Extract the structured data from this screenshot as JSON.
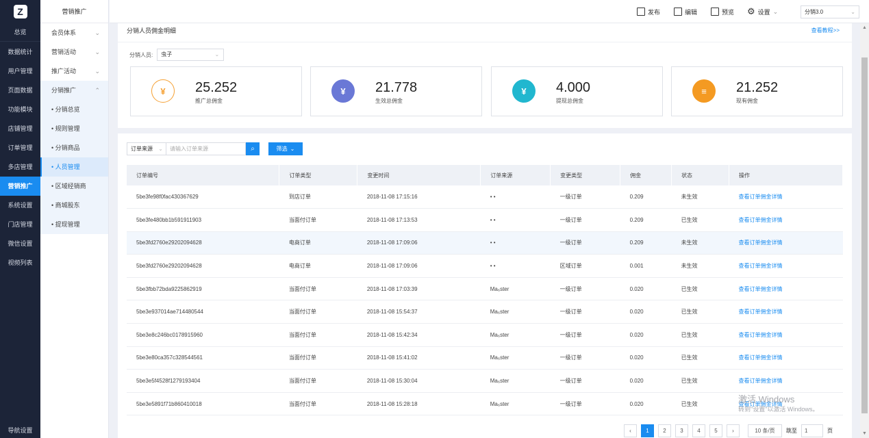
{
  "nav": {
    "logo": "Z",
    "items": [
      "总览",
      "数据统计",
      "用户管理",
      "页面数据",
      "功能模块",
      "店铺管理",
      "订单管理",
      "多店管理",
      "营销推广",
      "系统设置",
      "门店管理",
      "微信设置",
      "视频列表"
    ],
    "active_index": 8,
    "bottom": "导航设置"
  },
  "subnav": {
    "title": "营销推广",
    "groups": [
      {
        "label": "会员体系",
        "chev": "⌄"
      },
      {
        "label": "营销活动",
        "chev": "⌄"
      },
      {
        "label": "推广活动",
        "chev": "⌄"
      },
      {
        "label": "分销推广",
        "chev": "⌃"
      }
    ],
    "children": [
      "• 分销总览",
      "• 规则管理",
      "• 分销商品",
      "• 人员管理",
      "• 区域经销商",
      "• 商城股东",
      "• 提现管理"
    ],
    "active_child": 3
  },
  "topbar": {
    "publish": "发布",
    "edit": "编辑",
    "preview": "预览",
    "settings": "设置",
    "version": "分销3.0"
  },
  "page": {
    "title": "分销人员佣金明细",
    "help": "查看教程>>",
    "filter_label": "分销人员:",
    "filter_value": "虫子"
  },
  "stats": [
    {
      "value": "25.252",
      "label": "推广总佣金",
      "color": "#f5a033",
      "icon": "¥",
      "outline": true
    },
    {
      "value": "21.778",
      "label": "生效总佣金",
      "color": "#6a78d6",
      "icon": "¥",
      "outline": false
    },
    {
      "value": "4.000",
      "label": "提现总佣金",
      "color": "#21b7cf",
      "icon": "¥",
      "outline": false
    },
    {
      "value": "21.252",
      "label": "现有佣金",
      "color": "#f49a22",
      "icon": "≡",
      "outline": false
    }
  ],
  "search": {
    "source_select": "订单来源",
    "placeholder": "请输入订单来源",
    "filter_button": "筛选"
  },
  "table": {
    "headers": [
      "订单编号",
      "订单类型",
      "变更时间",
      "订单来源",
      "变更类型",
      "佣金",
      "状态",
      "操作"
    ],
    "rows": [
      [
        "5be3fe98f0fac430367629",
        "到店订单",
        "2018-11-08 17:15:16",
        "• •",
        "一级订单",
        "0.209",
        "未生效",
        "查看订单佣金详情"
      ],
      [
        "5be3fe480bb1b591911903",
        "当面付订单",
        "2018-11-08 17:13:53",
        "• •",
        "一级订单",
        "0.209",
        "已生效",
        "查看订单佣金详情"
      ],
      [
        "5be3fd2760e29202094628",
        "电商订单",
        "2018-11-08 17:09:06",
        "• •",
        "一级订单",
        "0.209",
        "未生效",
        "查看订单佣金详情"
      ],
      [
        "5be3fd2760e29202094628",
        "电商订单",
        "2018-11-08 17:09:06",
        "• •",
        "区域订单",
        "0.001",
        "未生效",
        "查看订单佣金详情"
      ],
      [
        "5be3fbb72bda9225862919",
        "当面付订单",
        "2018-11-08 17:03:39",
        "Ma₆ster",
        "一级订单",
        "0.020",
        "已生效",
        "查看订单佣金详情"
      ],
      [
        "5be3e937014ae714480544",
        "当面付订单",
        "2018-11-08 15:54:37",
        "Ma₆ster",
        "一级订单",
        "0.020",
        "已生效",
        "查看订单佣金详情"
      ],
      [
        "5be3e8c246bc0178915960",
        "当面付订单",
        "2018-11-08 15:42:34",
        "Ma₆ster",
        "一级订单",
        "0.020",
        "已生效",
        "查看订单佣金详情"
      ],
      [
        "5be3e80ca357c328544561",
        "当面付订单",
        "2018-11-08 15:41:02",
        "Ma₆ster",
        "一级订单",
        "0.020",
        "已生效",
        "查看订单佣金详情"
      ],
      [
        "5be3e5f4528f1279193404",
        "当面付订单",
        "2018-11-08 15:30:04",
        "Ma₆ster",
        "一级订单",
        "0.020",
        "已生效",
        "查看订单佣金详情"
      ],
      [
        "5be3e5891f71b860410018",
        "当面付订单",
        "2018-11-08 15:28:18",
        "Ma₆ster",
        "一级订单",
        "0.020",
        "已生效",
        "查看订单佣金详情"
      ]
    ],
    "highlight_row": 2
  },
  "pager": {
    "prev": "‹",
    "pages": [
      "1",
      "2",
      "3",
      "4",
      "5"
    ],
    "active": "1",
    "next": "›",
    "size": "10 条/页",
    "jump_label": "跳至",
    "jump_value": "1",
    "page_suffix": "页"
  },
  "watermark": {
    "line1": "激活 Windows",
    "line2": "转到\"设置\"以激活 Windows。"
  }
}
